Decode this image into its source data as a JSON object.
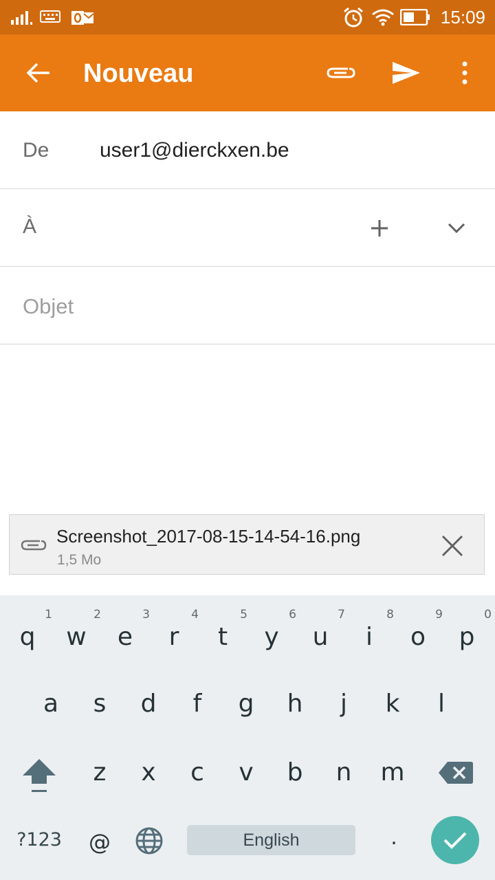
{
  "status_bar": {
    "time": "15:09",
    "icons": [
      "signal-icon",
      "keyboard-icon",
      "outlook-icon",
      "alarm-icon",
      "wifi-icon",
      "battery-icon"
    ]
  },
  "app_bar": {
    "title": "Nouveau",
    "color": "#ea7a12",
    "actions": [
      "back-arrow-icon",
      "paperclip-icon",
      "send-icon",
      "more-vert-icon"
    ]
  },
  "compose": {
    "from_label": "De",
    "from_value": "user1@dierckxen.be",
    "to_label": "À",
    "subject_placeholder": "Objet"
  },
  "attachment": {
    "filename": "Screenshot_2017-08-15-14-54-16.png",
    "size": "1,5 Mo"
  },
  "keyboard": {
    "row1": [
      "q",
      "w",
      "e",
      "r",
      "t",
      "y",
      "u",
      "i",
      "o",
      "p"
    ],
    "row1_hints": [
      "1",
      "2",
      "3",
      "4",
      "5",
      "6",
      "7",
      "8",
      "9",
      "0"
    ],
    "row2": [
      "a",
      "s",
      "d",
      "f",
      "g",
      "h",
      "j",
      "k",
      "l"
    ],
    "row3": [
      "z",
      "x",
      "c",
      "v",
      "b",
      "n",
      "m"
    ],
    "symbols_key": "?123",
    "at_key": "@",
    "space_label": "English",
    "period_key": ".",
    "enter_color": "#4db6ac"
  }
}
